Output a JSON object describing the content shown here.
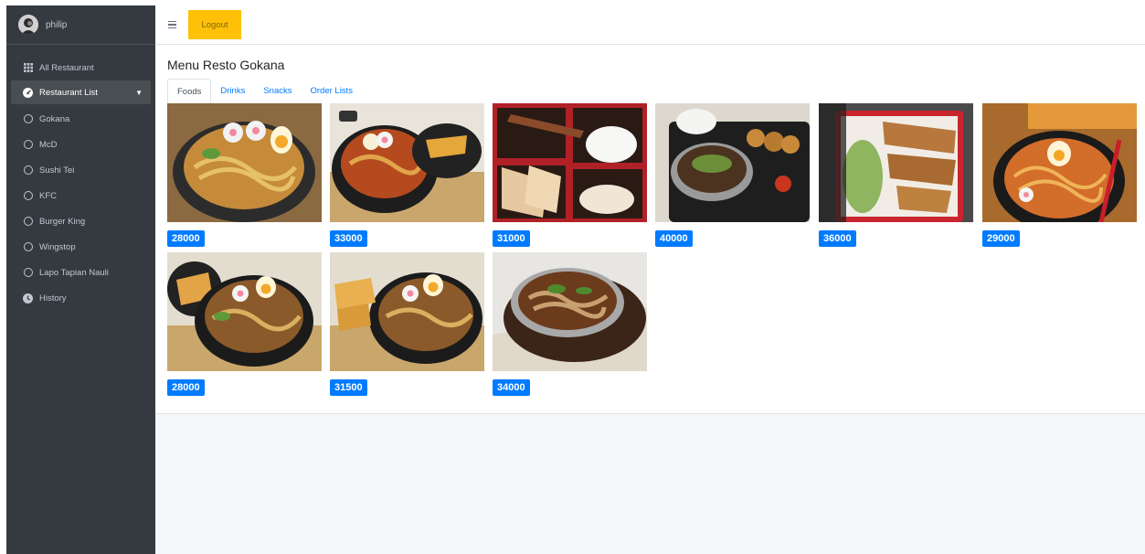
{
  "user": {
    "name": "philip"
  },
  "sidebar": {
    "items": [
      {
        "label": "All Restaurant",
        "icon": "grid-icon"
      },
      {
        "label": "Restaurant List",
        "icon": "dashboard-icon"
      },
      {
        "label": "Gokana",
        "icon": "circle-icon"
      },
      {
        "label": "McD",
        "icon": "circle-icon"
      },
      {
        "label": "Sushi Tei",
        "icon": "circle-icon"
      },
      {
        "label": "KFC",
        "icon": "circle-icon"
      },
      {
        "label": "Burger King",
        "icon": "circle-icon"
      },
      {
        "label": "Wingstop",
        "icon": "circle-icon"
      },
      {
        "label": "Lapo Tapian Nauli",
        "icon": "circle-icon"
      },
      {
        "label": "History",
        "icon": "clock-icon"
      }
    ]
  },
  "topbar": {
    "logout_label": "Logout"
  },
  "page": {
    "title": "Menu Resto Gokana"
  },
  "tabs": [
    {
      "label": "Foods"
    },
    {
      "label": "Drinks"
    },
    {
      "label": "Snacks"
    },
    {
      "label": "Order Lists"
    }
  ],
  "menu": [
    {
      "price": "28000"
    },
    {
      "price": "33000"
    },
    {
      "price": "31000"
    },
    {
      "price": "40000"
    },
    {
      "price": "36000"
    },
    {
      "price": "29000"
    },
    {
      "price": "28000"
    },
    {
      "price": "31500"
    },
    {
      "price": "34000"
    }
  ],
  "colors": {
    "sidebar": "#343a40",
    "accent": "#007bff",
    "logout": "#ffc107",
    "content_bg": "#f4f6f9"
  }
}
